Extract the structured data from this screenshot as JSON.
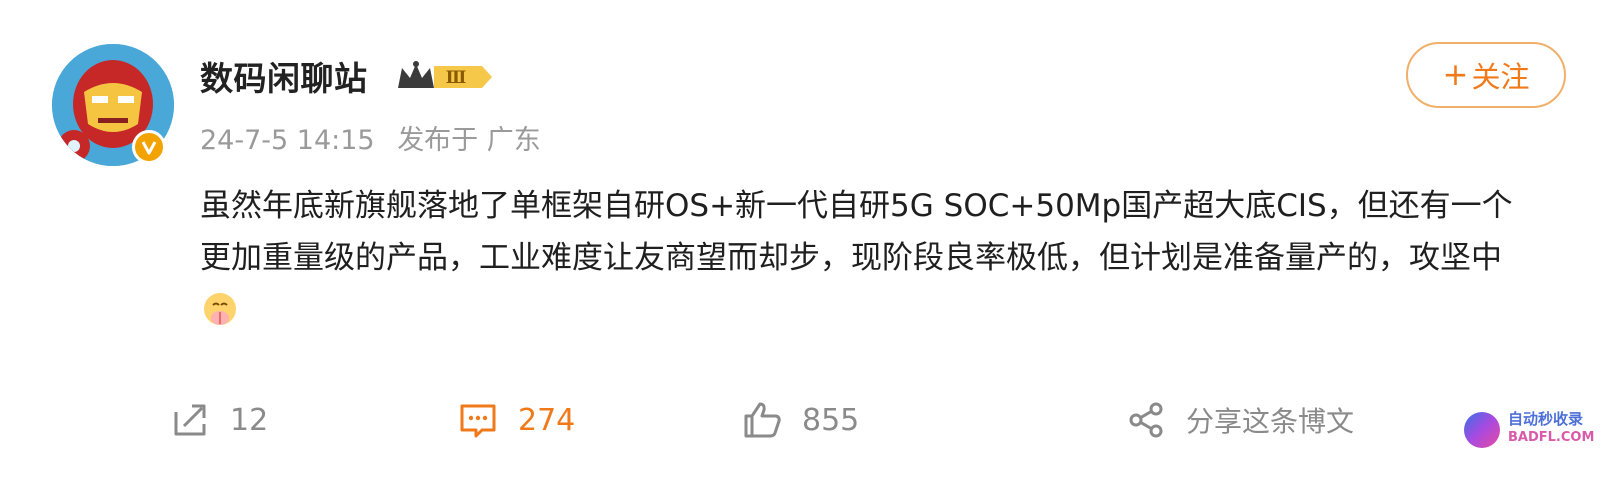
{
  "post": {
    "author": "数码闲聊站",
    "level_badge": "Ⅲ",
    "time": "24-7-5 14:15",
    "location_text": "发布于 广东",
    "follow_label": "关注",
    "follow_plus": "+",
    "text": "虽然年底新旗舰落地了单框架自研OS+新一代自研5G SOC+50Mp国产超大底CIS，但还有一个更加重量级的产品，工业难度让友商望而却步，现阶段良率极低，但计划是准备量产的，攻坚中",
    "emoji": "pray-emoji"
  },
  "actions": {
    "repost_count": "12",
    "comment_count": "274",
    "like_count": "855",
    "share_label": "分享这条博文"
  },
  "watermark": {
    "line1": "自动秒收录",
    "line2": "BADFL.COM"
  },
  "colors": {
    "accent": "#f07a1a",
    "follow_border": "#f0b06a",
    "meta": "#9a9a9a",
    "badge": "#f2a300"
  },
  "icons": [
    "repost-icon",
    "comment-icon",
    "like-icon",
    "share-icon",
    "verified-icon",
    "crown-icon"
  ]
}
